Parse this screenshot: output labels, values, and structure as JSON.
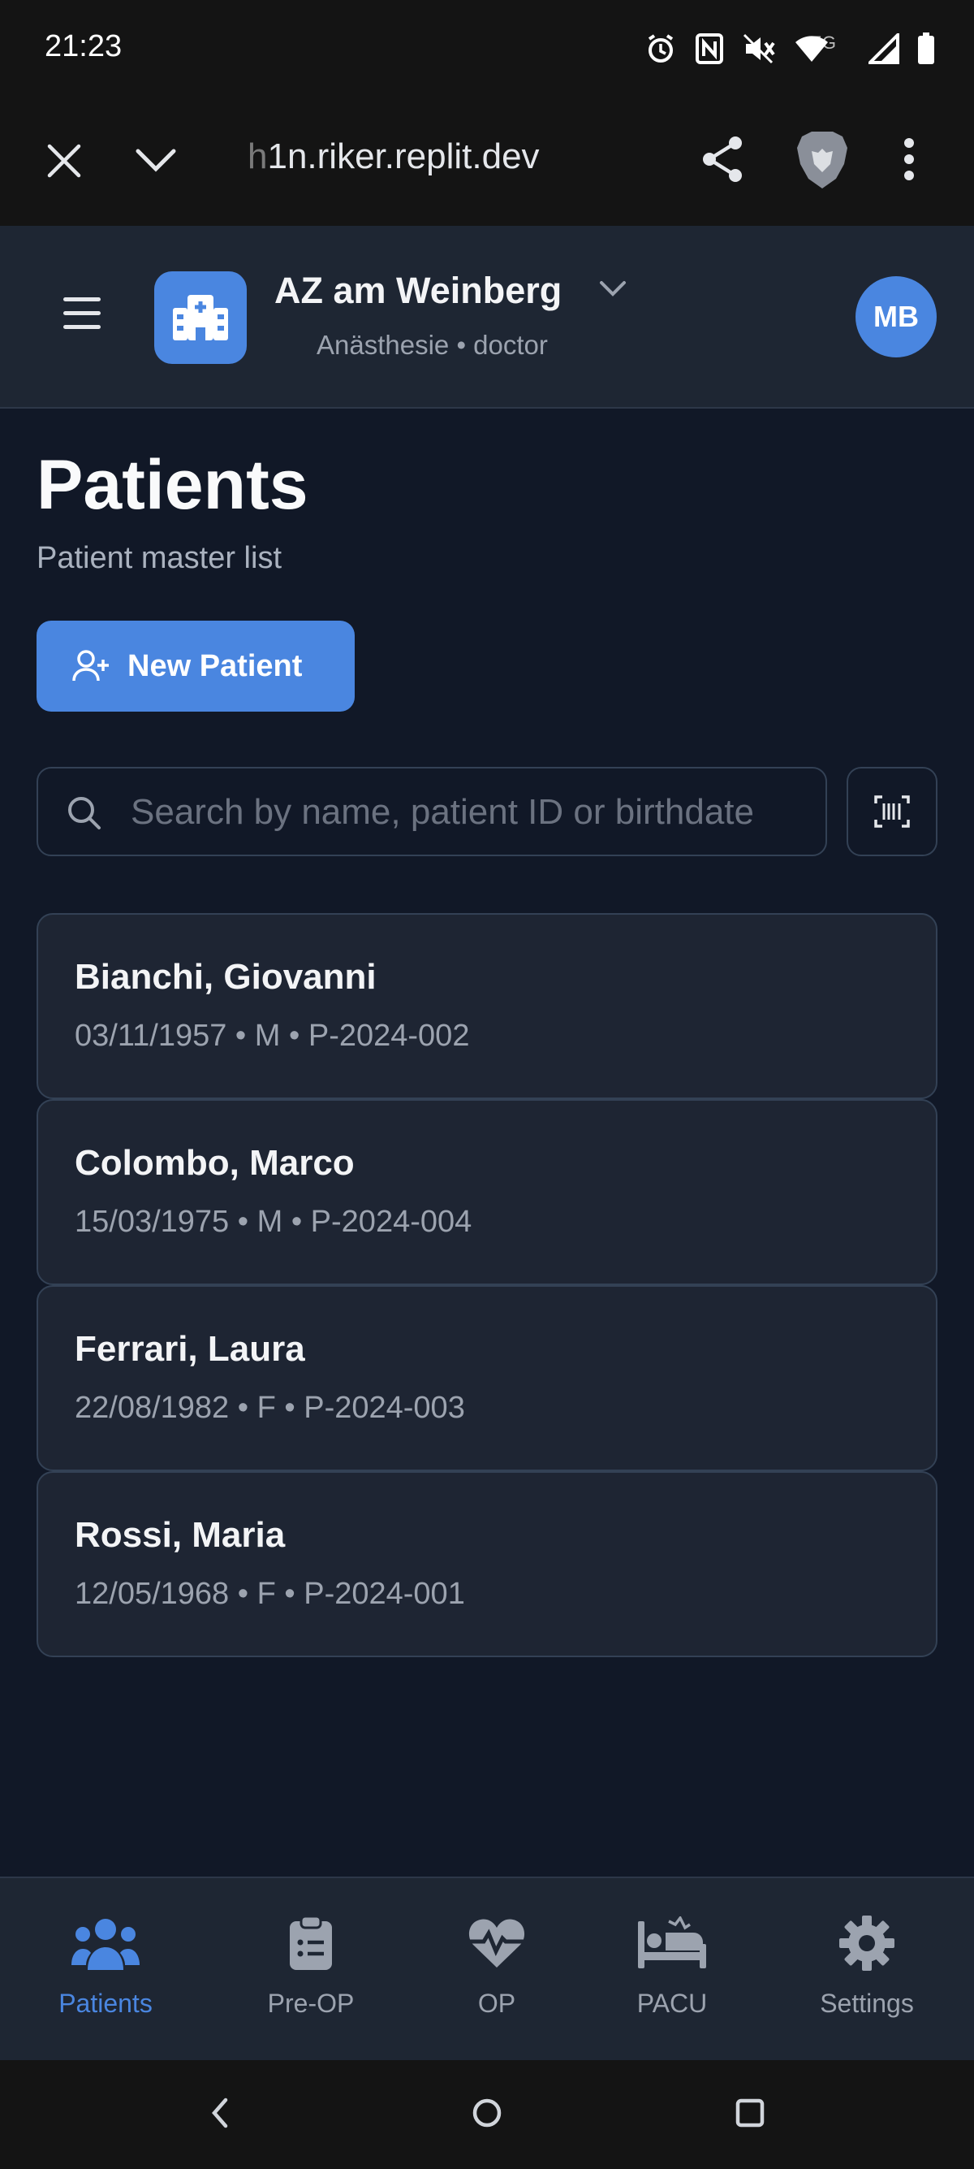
{
  "status_bar": {
    "time": "21:23",
    "network": "5G"
  },
  "browser": {
    "url_prefix": "h",
    "url": "1n.riker.replit.dev"
  },
  "header": {
    "clinic_name": "AZ am Weinberg",
    "subtitle": "Anästhesie • doctor",
    "avatar_initials": "MB"
  },
  "page": {
    "title": "Patients",
    "subtitle": "Patient master list",
    "new_patient_label": "New Patient",
    "search_placeholder": "Search by name, patient ID or birthdate"
  },
  "patients": [
    {
      "name": "Bianchi, Giovanni",
      "meta": "03/11/1957 • M • P-2024-002"
    },
    {
      "name": "Colombo, Marco",
      "meta": "15/03/1975 • M • P-2024-004"
    },
    {
      "name": "Ferrari, Laura",
      "meta": "22/08/1982 • F • P-2024-003"
    },
    {
      "name": "Rossi, Maria",
      "meta": "12/05/1968 • F • P-2024-001"
    }
  ],
  "bottom_nav": [
    {
      "label": "Patients",
      "icon": "users-icon",
      "active": true
    },
    {
      "label": "Pre-OP",
      "icon": "clipboard-list-icon",
      "active": false
    },
    {
      "label": "OP",
      "icon": "heart-pulse-icon",
      "active": false
    },
    {
      "label": "PACU",
      "icon": "bed-icon",
      "active": false
    },
    {
      "label": "Settings",
      "icon": "gear-icon",
      "active": false
    }
  ],
  "colors": {
    "accent": "#4a86e0",
    "background": "#111827",
    "card": "#1e2533",
    "header": "#1e2633"
  }
}
